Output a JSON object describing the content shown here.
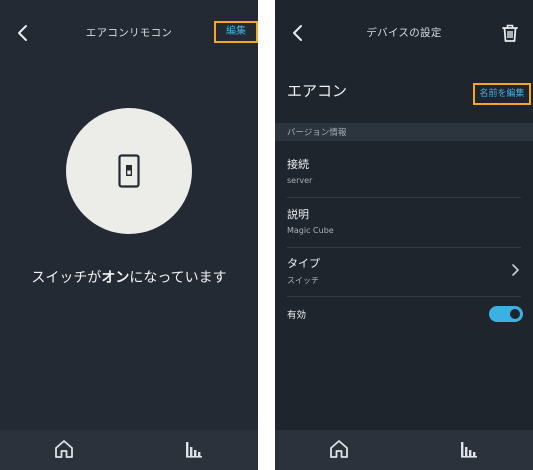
{
  "left_screen": {
    "header": {
      "title": "エアコンリモコン",
      "edit_label": "編集"
    },
    "status": {
      "prefix": "スイッチが",
      "state": "オン",
      "suffix": "になっています"
    },
    "icons": {
      "back": "chevron-left-icon",
      "switch": "light-switch-icon",
      "home": "home-icon",
      "activity": "bars-icon"
    }
  },
  "right_screen": {
    "header": {
      "title": "デバイスの設定"
    },
    "device_name": "エアコン",
    "rename_label": "名前を編集",
    "section_title": "バージョン情報",
    "rows": [
      {
        "label": "接続",
        "value": "server"
      },
      {
        "label": "説明",
        "value": "Magic Cube"
      },
      {
        "label": "タイプ",
        "value": "スイッチ"
      }
    ],
    "enabled_label": "有効",
    "enabled": true,
    "colors": {
      "accent": "#3cb0e4",
      "highlight_border": "#f5a623"
    }
  }
}
